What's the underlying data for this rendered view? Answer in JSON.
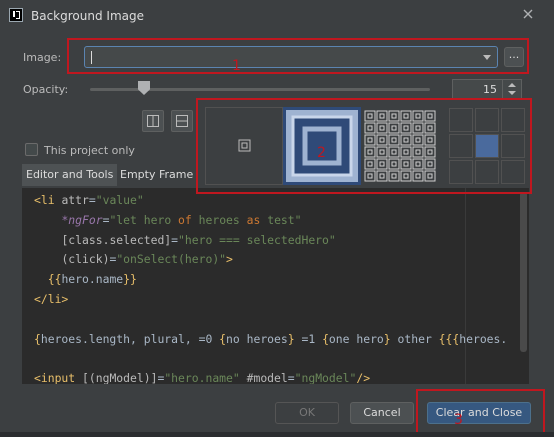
{
  "dialog": {
    "title": "Background Image"
  },
  "image": {
    "label": "Image:",
    "value": "",
    "browse_label": "..."
  },
  "opacity": {
    "label": "Opacity:",
    "value": "15",
    "slider_fraction": 0.15
  },
  "options": {
    "this_project_only": "This project only",
    "checked": false
  },
  "tabs": [
    {
      "label": "Editor and Tools",
      "selected": true
    },
    {
      "label": "Empty Frame",
      "selected": false
    }
  ],
  "code_lines": [
    [
      [
        "tk-tag",
        "<li "
      ],
      [
        "tk-attr",
        "attr"
      ],
      [
        "tk-plain",
        "="
      ],
      [
        "tk-str",
        "\"value\""
      ]
    ],
    [
      [
        "tk-plain",
        "    "
      ],
      [
        "tk-ng",
        "*ngFor"
      ],
      [
        "tk-plain",
        "="
      ],
      [
        "tk-str",
        "\"let "
      ],
      [
        "tk-str",
        "hero "
      ],
      [
        "tk-kw",
        "of"
      ],
      [
        "tk-str",
        " heroes "
      ],
      [
        "tk-kw",
        "as"
      ],
      [
        "tk-str",
        " test\""
      ]
    ],
    [
      [
        "tk-plain",
        "    "
      ],
      [
        "tk-attr",
        "[class.selected]"
      ],
      [
        "tk-plain",
        "="
      ],
      [
        "tk-str",
        "\"hero === selectedHero\""
      ]
    ],
    [
      [
        "tk-plain",
        "    "
      ],
      [
        "tk-attr",
        "(click)"
      ],
      [
        "tk-plain",
        "="
      ],
      [
        "tk-str",
        "\"onSelect(hero)\""
      ],
      [
        "tk-tag",
        ">"
      ]
    ],
    [
      [
        "tk-plain",
        "  "
      ],
      [
        "tk-brace",
        "{{"
      ],
      [
        "tk-plain",
        "hero.name"
      ],
      [
        "tk-brace",
        "}}"
      ]
    ],
    [
      [
        "tk-tag",
        "</li>"
      ]
    ],
    [
      [
        "tk-plain",
        ""
      ]
    ],
    [
      [
        "tk-brace",
        "{"
      ],
      [
        "tk-plain",
        "heroes.length, plural, =0 "
      ],
      [
        "tk-brace",
        "{"
      ],
      [
        "tk-plain",
        "no heroes"
      ],
      [
        "tk-brace",
        "}"
      ],
      [
        "tk-plain",
        " =1 "
      ],
      [
        "tk-brace",
        "{"
      ],
      [
        "tk-plain",
        "one hero"
      ],
      [
        "tk-brace",
        "}"
      ],
      [
        "tk-plain",
        " other "
      ],
      [
        "tk-brace",
        "{{{"
      ],
      [
        "tk-plain",
        "heroes."
      ]
    ],
    [
      [
        "tk-plain",
        ""
      ]
    ],
    [
      [
        "tk-tag",
        "<input "
      ],
      [
        "tk-attr",
        "[(ngModel)]"
      ],
      [
        "tk-plain",
        "="
      ],
      [
        "tk-str",
        "\"hero.name\""
      ],
      [
        "tk-plain",
        " "
      ],
      [
        "tk-attr",
        "#model"
      ],
      [
        "tk-plain",
        "="
      ],
      [
        "tk-str",
        "\"ngModel\""
      ],
      [
        "tk-tag",
        "/>"
      ]
    ]
  ],
  "buttons": {
    "ok": "OK",
    "cancel": "Cancel",
    "clear_close": "Clear and Close"
  },
  "annotations": {
    "n1": "1",
    "n2": "2",
    "n3": "3"
  },
  "colors": {
    "accent": "#365880",
    "annotation": "#c0171f",
    "tile_selected": "#4a6a9d"
  }
}
